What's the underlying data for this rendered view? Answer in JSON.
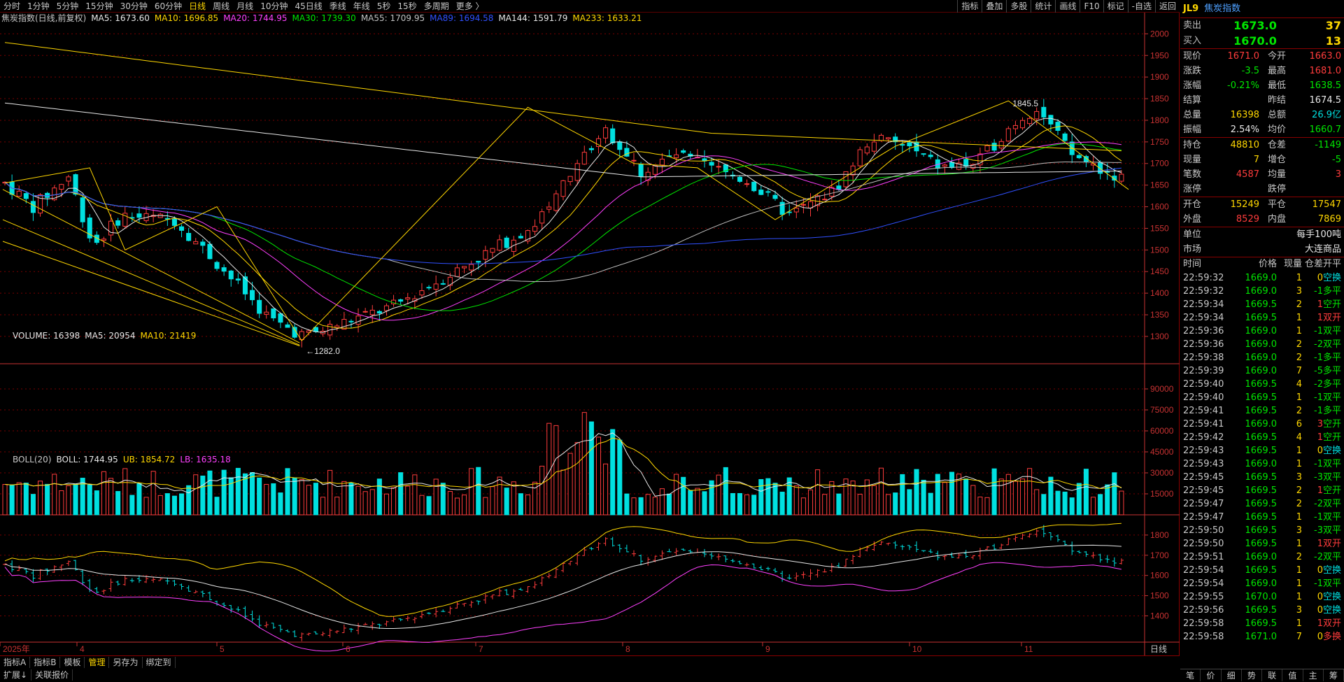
{
  "topbar": {
    "periods": [
      "分时",
      "1分钟",
      "5分钟",
      "15分钟",
      "30分钟",
      "60分钟",
      "日线",
      "周线",
      "月线",
      "10分钟",
      "45日线",
      "季线",
      "年线",
      "5秒",
      "15秒",
      "多周期",
      "更多 〉"
    ],
    "active_period": "日线",
    "tools": [
      "指标",
      "叠加",
      "多股",
      "统计",
      "画线",
      "F10",
      "标记",
      "-自选",
      "返回"
    ]
  },
  "kline": {
    "title": "焦炭指数(日线,前复权)",
    "mas": [
      {
        "label": "MA5: 1673.60",
        "color": "#e8e8e8"
      },
      {
        "label": "MA10: 1696.85",
        "color": "#ffd700"
      },
      {
        "label": "MA20: 1744.95",
        "color": "#ff40ff"
      },
      {
        "label": "MA30: 1739.30",
        "color": "#00e600"
      },
      {
        "label": "MA55: 1709.95",
        "color": "#c0c0c0"
      },
      {
        "label": "MA89: 1694.58",
        "color": "#3050ff"
      },
      {
        "label": "MA144: 1591.79",
        "color": "#e8e8e8"
      },
      {
        "label": "MA233: 1633.21",
        "color": "#ffd700"
      }
    ],
    "y_ticks": [
      "2000",
      "1950",
      "1900",
      "1850",
      "1800",
      "1750",
      "1700",
      "1650",
      "1600",
      "1550",
      "1500",
      "1450",
      "1400",
      "1350",
      "1300"
    ],
    "low_label": "1282.0",
    "high_label": "1845.5"
  },
  "volume": {
    "title": "VOLUME: 16398",
    "ma5": "MA5: 20954",
    "ma10": "MA10: 21419",
    "y_ticks": [
      "90000",
      "75000",
      "60000",
      "45000",
      "30000",
      "15000"
    ]
  },
  "boll": {
    "title": "BOLL(20)",
    "boll": "BOLL: 1744.95",
    "ub": "UB: 1854.72",
    "lb": "LB: 1635.18",
    "y_ticks": [
      "1800",
      "1700",
      "1600",
      "1500",
      "1400"
    ]
  },
  "x_axis": {
    "labels": [
      "2025年",
      "4",
      "5",
      "6",
      "7",
      "8",
      "9",
      "10",
      "11"
    ],
    "right_label": "日线"
  },
  "bottom": {
    "row1": [
      "指标A",
      "指标B",
      "模板",
      "管理",
      "另存为",
      "绑定到"
    ],
    "active": "管理",
    "row2": [
      "扩展↓",
      "关联报价"
    ]
  },
  "quote": {
    "code": "JL9",
    "name": "焦炭指数",
    "sell_label": "卖出",
    "sell_price": "1673.0",
    "sell_vol": "37",
    "buy_label": "买入",
    "buy_price": "1670.0",
    "buy_vol": "13",
    "rows1": [
      [
        "现价",
        "1671.0",
        "red",
        "今开",
        "1663.0",
        "red"
      ],
      [
        "涨跌",
        "-3.5",
        "green",
        "最高",
        "1681.0",
        "red"
      ],
      [
        "涨幅",
        "-0.21%",
        "green",
        "最低",
        "1638.5",
        "green"
      ],
      [
        "结算",
        "",
        "white",
        "昨结",
        "1674.5",
        "white"
      ],
      [
        "总量",
        "16398",
        "yellow",
        "总额",
        "26.9亿",
        "cyan"
      ],
      [
        "振幅",
        "2.54%",
        "white",
        "均价",
        "1660.7",
        "green"
      ]
    ],
    "rows2": [
      [
        "持仓",
        "48810",
        "yellow",
        "仓差",
        "-1149",
        "green"
      ],
      [
        "现量",
        "7",
        "yellow",
        "增仓",
        "-5",
        "green"
      ],
      [
        "笔数",
        "4587",
        "red",
        "均量",
        "3",
        "red"
      ],
      [
        "涨停",
        "",
        "white",
        "跌停",
        "",
        "white"
      ]
    ],
    "rows3": [
      [
        "开仓",
        "15249",
        "yellow",
        "平仓",
        "17547",
        "yellow"
      ],
      [
        "外盘",
        "8529",
        "red",
        "内盘",
        "7869",
        "yellow"
      ]
    ],
    "rows4": [
      [
        "单位",
        "每手100吨"
      ],
      [
        "市场",
        "大连商品"
      ]
    ],
    "tick_header": [
      "时间",
      "价格",
      "现量",
      "仓差",
      "开平"
    ],
    "ticks": [
      [
        "22:59:32",
        "1669.0",
        "1",
        "0",
        "空换",
        "green",
        "cyan"
      ],
      [
        "22:59:32",
        "1669.0",
        "3",
        "-1",
        "多平",
        "green",
        "green"
      ],
      [
        "22:59:34",
        "1669.5",
        "2",
        "1",
        "空开",
        "green",
        "green"
      ],
      [
        "22:59:34",
        "1669.5",
        "1",
        "1",
        "双开",
        "green",
        "red"
      ],
      [
        "22:59:36",
        "1669.0",
        "1",
        "-1",
        "双平",
        "green",
        "green"
      ],
      [
        "22:59:36",
        "1669.0",
        "2",
        "-2",
        "双平",
        "green",
        "green"
      ],
      [
        "22:59:38",
        "1669.0",
        "2",
        "-1",
        "多平",
        "green",
        "green"
      ],
      [
        "22:59:39",
        "1669.0",
        "7",
        "-5",
        "多平",
        "green",
        "green"
      ],
      [
        "22:59:40",
        "1669.5",
        "4",
        "-2",
        "多平",
        "green",
        "green"
      ],
      [
        "22:59:40",
        "1669.5",
        "1",
        "-1",
        "双平",
        "green",
        "green"
      ],
      [
        "22:59:41",
        "1669.5",
        "2",
        "-1",
        "多平",
        "green",
        "green"
      ],
      [
        "22:59:41",
        "1669.0",
        "6",
        "3",
        "空开",
        "green",
        "green"
      ],
      [
        "22:59:42",
        "1669.5",
        "4",
        "1",
        "空开",
        "green",
        "green"
      ],
      [
        "22:59:43",
        "1669.5",
        "1",
        "0",
        "空换",
        "green",
        "cyan"
      ],
      [
        "22:59:43",
        "1669.0",
        "1",
        "-1",
        "双平",
        "green",
        "green"
      ],
      [
        "22:59:45",
        "1669.5",
        "3",
        "-3",
        "双平",
        "green",
        "green"
      ],
      [
        "22:59:45",
        "1669.5",
        "2",
        "1",
        "空开",
        "green",
        "green"
      ],
      [
        "22:59:47",
        "1669.5",
        "2",
        "-2",
        "双平",
        "green",
        "green"
      ],
      [
        "22:59:47",
        "1669.5",
        "1",
        "-1",
        "双平",
        "green",
        "green"
      ],
      [
        "22:59:50",
        "1669.5",
        "3",
        "-3",
        "双平",
        "green",
        "green"
      ],
      [
        "22:59:50",
        "1669.5",
        "1",
        "1",
        "双开",
        "green",
        "red"
      ],
      [
        "22:59:51",
        "1669.0",
        "2",
        "-2",
        "双平",
        "green",
        "green"
      ],
      [
        "22:59:54",
        "1669.5",
        "1",
        "0",
        "空换",
        "green",
        "cyan"
      ],
      [
        "22:59:54",
        "1669.0",
        "1",
        "-1",
        "双平",
        "green",
        "green"
      ],
      [
        "22:59:55",
        "1670.0",
        "1",
        "0",
        "空换",
        "green",
        "cyan"
      ],
      [
        "22:59:56",
        "1669.5",
        "3",
        "0",
        "空换",
        "green",
        "cyan"
      ],
      [
        "22:59:58",
        "1669.5",
        "1",
        "1",
        "双开",
        "green",
        "red"
      ],
      [
        "22:59:58",
        "1671.0",
        "7",
        "0",
        "多换",
        "green",
        "red"
      ]
    ],
    "tabs": [
      "笔",
      "价",
      "细",
      "势",
      "联",
      "值",
      "主",
      "筹"
    ]
  },
  "colors": {
    "up": "#ff3c3c",
    "down": "#00e0e0",
    "grid": "#7a0000",
    "axis": "#c83232"
  }
}
